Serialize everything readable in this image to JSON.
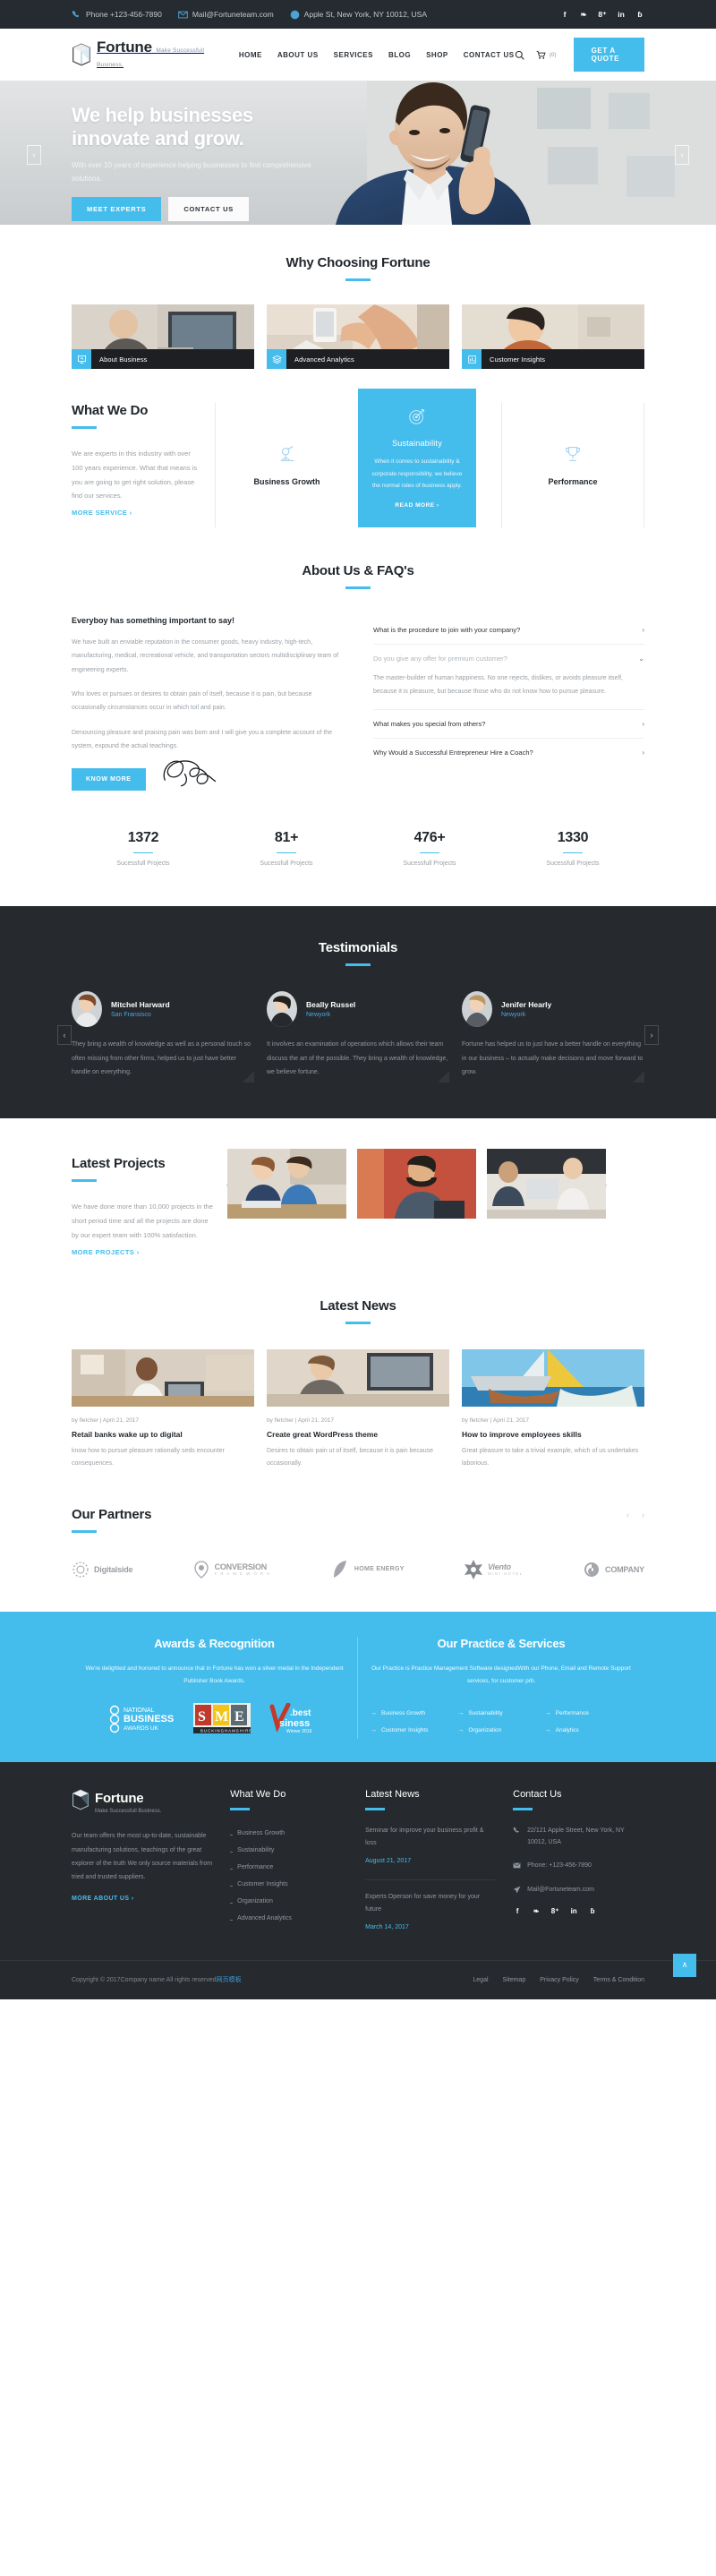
{
  "topbar": {
    "phone": "Phone +123-456-7890",
    "mail": "Mail@Fortuneteam.com",
    "address": "Apple St, New York, NY 10012, USA",
    "social": [
      "f",
      "❧",
      "8⁺",
      "in",
      "ɓ"
    ],
    "bg": "#262b31"
  },
  "header": {
    "brand_title": "Fortune",
    "brand_sub": "Make Successfull Business.",
    "nav": [
      {
        "label": "HOME"
      },
      {
        "label": "ABOUT US"
      },
      {
        "label": "SERVICES"
      },
      {
        "label": "BLOG"
      },
      {
        "label": "SHOP"
      },
      {
        "label": "CONTACT US"
      }
    ],
    "cart_count": "(0)",
    "quote_label": "GET A QUOTE",
    "accent": "#45bdec"
  },
  "hero": {
    "title_line1": "We help businesses",
    "title_line2": "innovate and grow.",
    "subtitle": "With over 10 years of experience helping businesses to find comprehensive solutions.",
    "btn_primary": "MEET EXPERTS",
    "btn_secondary": "CONTACT US",
    "prev": "‹",
    "next": "›"
  },
  "why": {
    "title": "Why Choosing Fortune",
    "cards": [
      {
        "label": "About Business",
        "icon": "presentation-icon"
      },
      {
        "label": "Advanced Analytics",
        "icon": "layers-icon"
      },
      {
        "label": "Customer Insights",
        "icon": "chart-icon"
      }
    ]
  },
  "what_we_do": {
    "title": "What We Do",
    "text": "We are experts in this industry with over 100 years experience. What that means is you are going to get right solution, please find our services.",
    "more_label": "MORE SERVICE ›",
    "items": [
      {
        "name": "Business Growth",
        "icon": "growth-icon"
      },
      {
        "name": "Performance",
        "icon": "trophy-icon"
      }
    ],
    "feature": {
      "title": "Sustainability",
      "text": "When it comes to sustainability & corporate responsibility, we believe the normal rules of business apply.",
      "link": "READ MORE ›",
      "icon": "target-icon"
    }
  },
  "about": {
    "title": "About Us & FAQ's",
    "lead": "Everyboy has something important to say!",
    "paragraphs": [
      "We have built an enviable reputation in the consumer goods, heavy industry, high-tech, manufacturing, medical, recreational vehicle, and transportation sectors multidisciplinary team of engineering experts.",
      "Who loves or pursues or desires to obtain pain of itself, because it is pain, but because occasionally circumstances occur in which toil and pain.",
      "Denouncing pleasure and praising pain was born and I will give you a complete account of the system, expound the actual teachings."
    ],
    "know_more": "KNOW MORE",
    "faqs": [
      {
        "q": "What is the procedure to join with your company?",
        "open": false,
        "a": ""
      },
      {
        "q": "Do you give any offer for premium customer?",
        "open": true,
        "a": "The master-builder of human happiness. No one rejects, dislikes, or avoids pleasure itself, because it is pleasure, but because those who do not know how to pursue pleasure."
      },
      {
        "q": "What makes you special from others?",
        "open": false,
        "a": ""
      },
      {
        "q": "Why Would a Successful Entrepreneur Hire a Coach?",
        "open": false,
        "a": ""
      }
    ]
  },
  "counters": [
    {
      "num": "1372",
      "label": "Sucessfull Projects"
    },
    {
      "num": "81+",
      "label": "Sucessfull Projects"
    },
    {
      "num": "476+",
      "label": "Sucessfull Projects"
    },
    {
      "num": "1330",
      "label": "Sucessfull Projects"
    }
  ],
  "testimonials": {
    "title": "Testimonials",
    "prev": "‹",
    "next": "›",
    "items": [
      {
        "name": "Mitchel Harward",
        "city": "San Fransisco",
        "text": "They bring a wealth of knowledge as well as a personal touch so often missing from other firms, helped us to just have better handle on everything."
      },
      {
        "name": "Beally Russel",
        "city": "Newyork",
        "text": "It involves an examination of operations which allows their team discuss the art of the possible. They bring a wealth of knowledge, we believe fortune."
      },
      {
        "name": "Jenifer Hearly",
        "city": "Newyork",
        "text": "Fortune has helped us to just have a better handle on everything in our business – to actually make decisions and move forward to grow."
      }
    ]
  },
  "projects": {
    "title": "Latest Projects",
    "text": "We have done more than 10,000 projects in the short period time and all the projects are done by our expert team with 100% satisfaction.",
    "more_label": "MORE PROJECTS ›",
    "prev": "‹",
    "next": "›"
  },
  "news": {
    "title": "Latest News",
    "items": [
      {
        "meta": "by fletcher | April 21, 2017",
        "title": "Retail banks wake up to digital",
        "excerpt": "know how to pursue pleasure rationally seds encounter consequences."
      },
      {
        "meta": "by fletcher | April 21, 2017",
        "title": "Create great WordPress theme",
        "excerpt": "Desires to obtain pain ut of itself, because it is pain because occasionally."
      },
      {
        "meta": "by fletcher | April 21, 2017",
        "title": "How to improve employees skills",
        "excerpt": "Great pleasure to take a trivial example, which of us undertakes laborious."
      }
    ]
  },
  "partners": {
    "title": "Our Partners",
    "prev": "‹",
    "next": "›",
    "items": [
      {
        "name": "Digitalside",
        "sub": ""
      },
      {
        "name": "CONVERSION",
        "sub": "F R A M E W O R K"
      },
      {
        "name": "HOME ENERGY",
        "sub": ""
      },
      {
        "name": "Viento",
        "sub": "MINI HOTEL"
      },
      {
        "name": "COMPANY",
        "sub": ""
      }
    ]
  },
  "awards": {
    "left_title": "Awards & Recognition",
    "left_text": "We're delighted and honored to announce that in Fortune has won a silver medal in the Independent Publisher Book Awards.",
    "logos": [
      "NATIONAL BUSINESS AWARDS UK",
      "SME BUCKINGHAMSHIRE",
      "best business Winner 2016"
    ],
    "right_title": "Our Practice & Services",
    "right_text": "Our Practice is Practice Management Software designedWith our Phone, Email and Remote Support services, for customer prb.",
    "services": [
      "Business Growth",
      "Sustainability",
      "Performance",
      "Customer Insights",
      "Organization",
      "Analytics"
    ]
  },
  "footer": {
    "brand_title": "Fortune",
    "brand_sub": "Make Successfull Business.",
    "about_text": "Our team offers the most up-to-date, sustainable manufacturing solutions, teachings of the great explorer of the truth We only source materials from tried and trusted suppliers.",
    "more_about": "MORE ABOUT US ›",
    "wwd_title": "What We Do",
    "wwd_links": [
      "Business Growth",
      "Sustainability",
      "Performance",
      "Customer Insights",
      "Organization",
      "Advanced Analytics"
    ],
    "news_title": "Latest News",
    "news": [
      {
        "text": "Seminar for improve your business profit & loss",
        "date": "August 21, 2017"
      },
      {
        "text": "Experts Operson for save money for your future",
        "date": "March 14, 2017"
      }
    ],
    "contact_title": "Contact Us",
    "address": "22/121 Apple Street, New York, NY 10012, USA",
    "phone": "Phone: +123-456-7890",
    "mail": "Mail@Fortuneteam.com",
    "social": [
      "f",
      "❧",
      "8⁺",
      "in",
      "ɓ"
    ],
    "copyright_pre": "Copyright © 2017Company name All rights reserved",
    "copyright_cn": "网页模板",
    "links": [
      "Legal",
      "Sitemap",
      "Privacy Policy",
      "Terms & Condition"
    ],
    "to_top": "∧"
  }
}
